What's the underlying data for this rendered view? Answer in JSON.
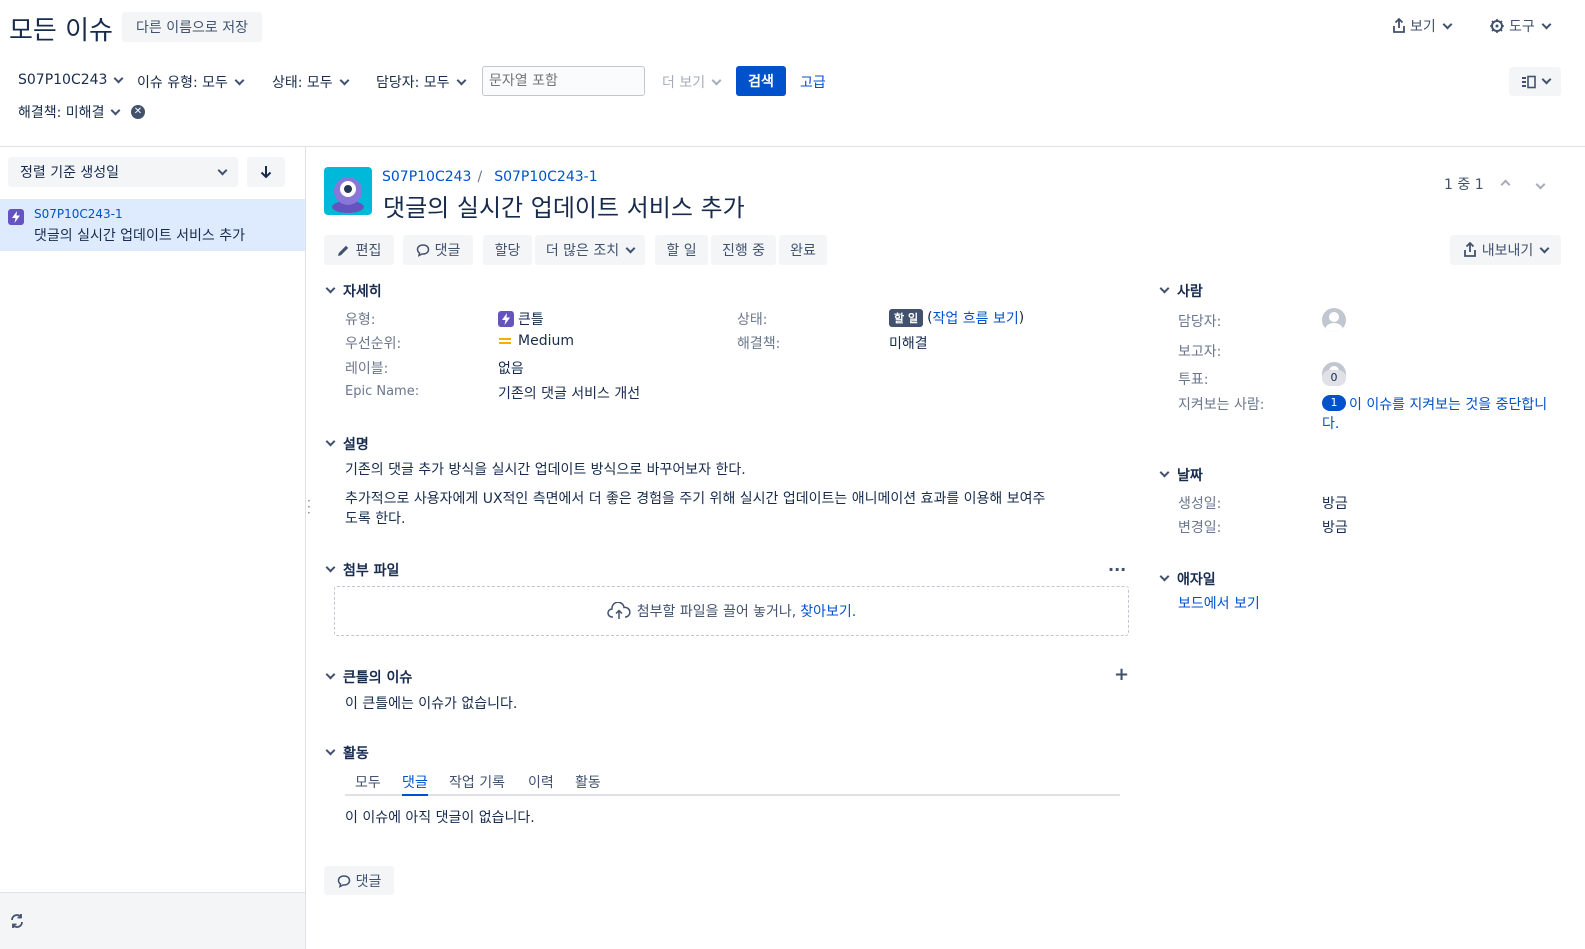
{
  "header": {
    "title": "모든 이슈",
    "save_as": "다른 이름으로 저장",
    "view": "보기",
    "tools": "도구"
  },
  "filters": {
    "project": "S07P10C243",
    "issue_type": "이슈 유형: 모두",
    "status": "상태: 모두",
    "assignee": "담당자: 모두",
    "text_placeholder": "문자열 포함",
    "more": "더 보기",
    "search": "검색",
    "advanced": "고급",
    "resolution": "해결책: 미해결"
  },
  "sidebar": {
    "sort_label": "정렬 기준 생성일",
    "items": [
      {
        "key": "S07P10C243-1",
        "summary": "댓글의 실시간 업데이트 서비스 추가"
      }
    ]
  },
  "issue": {
    "breadcrumb_project": "S07P10C243",
    "breadcrumb_sep": "/",
    "breadcrumb_key": "S07P10C243-1",
    "title": "댓글의 실시간 업데이트 서비스 추가",
    "pager": "1 중 1",
    "actions": {
      "edit": "편집",
      "comment": "댓글",
      "assign": "할당",
      "more_actions": "더 많은 조치",
      "todo": "할 일",
      "in_progress": "진행 중",
      "done": "완료",
      "export": "내보내기"
    }
  },
  "details": {
    "section": "자세히",
    "type_label": "유형:",
    "type_value": "큰틀",
    "priority_label": "우선순위:",
    "priority_value": "Medium",
    "labels_label": "레이블:",
    "labels_value": "없음",
    "epic_name_label": "Epic Name:",
    "epic_name_value": "기존의 댓글 서비스 개선",
    "status_label": "상태:",
    "status_value": "할 일",
    "status_open": "(",
    "status_workflow": "작업 흐름 보기",
    "status_close": ")",
    "resolution_label": "해결책:",
    "resolution_value": "미해결"
  },
  "description": {
    "section": "설명",
    "p1": "기존의 댓글 추가 방식을 실시간 업데이트 방식으로 바꾸어보자 한다.",
    "p2_line1": "추가적으로 사용자에게 UX적인 측면에서 더 좋은 경험을 주기 위해 실시간 업데이트는 애니메이션 효과를 이용해 보여주",
    "p2_line2": "도록 한다."
  },
  "attachments": {
    "section": "첨부 파일",
    "drop_text": "첨부할 파일을 끌어 놓거나, ",
    "browse": "찾아보기."
  },
  "epic_issues": {
    "section": "큰틀의 이슈",
    "empty": "이 큰틀에는 이슈가 없습니다."
  },
  "activity": {
    "section": "활동",
    "tabs": [
      "모두",
      "댓글",
      "작업 기록",
      "이력",
      "활동"
    ],
    "active_tab": "댓글",
    "empty": "이 이슈에 아직 댓글이 없습니다.",
    "comment_button": "댓글"
  },
  "people": {
    "section": "사람",
    "assignee_label": "담당자:",
    "reporter_label": "보고자:",
    "votes_label": "투표:",
    "votes_value": "0",
    "watchers_label": "지켜보는 사람:",
    "watchers_count": "1",
    "watch_line1": "이 이슈를 지켜보는 것을 중단합니",
    "watch_line2": "다."
  },
  "dates": {
    "section": "날짜",
    "created_label": "생성일:",
    "created_value": "방금",
    "updated_label": "변경일:",
    "updated_value": "방금"
  },
  "agile": {
    "section": "애자일",
    "board_link": "보드에서 보기"
  },
  "colors": {
    "primary": "#0052cc",
    "epic": "#6554c0",
    "selected_bg": "#deebff",
    "status_bg": "#42526e",
    "priority": "#ffab00"
  }
}
